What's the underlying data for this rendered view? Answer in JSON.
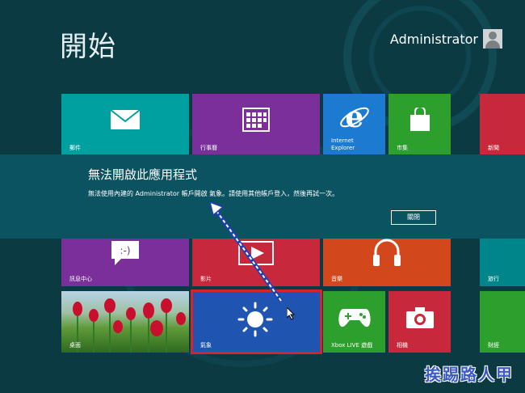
{
  "header": {
    "title": "開始",
    "user_name": "Administrator"
  },
  "tiles": {
    "mail": "郵件",
    "calendar": "行事曆",
    "ie": "Internet\nExplorer",
    "store": "市集",
    "news": "新聞",
    "messaging": "訊息中心",
    "video": "影片",
    "music": "音樂",
    "travel": "旅行",
    "desktop": "桌面",
    "weather": "氣象",
    "xbox": "Xbox LIVE 遊戲",
    "camera": "相機",
    "finance": "財經"
  },
  "dialog": {
    "title": "無法開啟此應用程式",
    "message": "無法使用內建的 Administrator 帳戶開啟 氣象。請使用其他帳戶登入，然後再試一次。",
    "close_button": "關閉"
  },
  "watermark": "挨踢路人甲",
  "colors": {
    "background": "#0b3a43",
    "dialog": "#0b5360",
    "teal_tile": "#00a0a0",
    "purple_tile": "#7a2f9a",
    "blue_tile": "#1d7ad1",
    "green_tile": "#2c9f2c",
    "red_tile": "#c8283b",
    "orange_tile": "#d2481c",
    "weather_tile": "#1f55b0",
    "selection": "#d8232a"
  }
}
